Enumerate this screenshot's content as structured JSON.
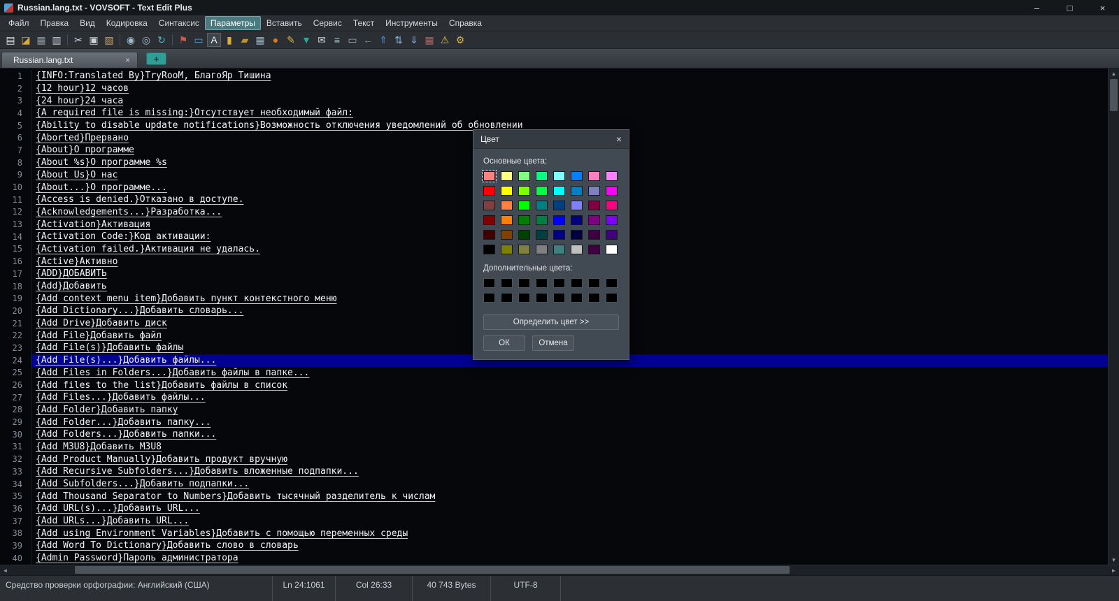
{
  "window": {
    "title": "Russian.lang.txt - VOVSOFT - Text Edit Plus",
    "minimize_glyph": "–",
    "maximize_glyph": "□",
    "close_glyph": "×"
  },
  "menu": {
    "items": [
      "Файл",
      "Правка",
      "Вид",
      "Кодировка",
      "Синтаксис",
      "Параметры",
      "Вставить",
      "Сервис",
      "Текст",
      "Инструменты",
      "Справка"
    ],
    "active_index": 5
  },
  "toolbar": {
    "icons": [
      {
        "name": "new-file-icon",
        "glyph": "▤",
        "color": "#dde1e5"
      },
      {
        "name": "open-folder-icon",
        "glyph": "◪",
        "color": "#dfa92f"
      },
      {
        "name": "save-icon",
        "glyph": "▦",
        "color": "#8d979e"
      },
      {
        "name": "print-icon",
        "glyph": "▥",
        "color": "#c6cbd0"
      },
      {
        "separator": true
      },
      {
        "name": "cut-icon",
        "glyph": "✂",
        "color": "#d5d9dd"
      },
      {
        "name": "copy-icon",
        "glyph": "▣",
        "color": "#cdd2d6"
      },
      {
        "name": "paste-icon",
        "glyph": "▧",
        "color": "#c9a05b"
      },
      {
        "separator": true
      },
      {
        "name": "zoom-in-icon",
        "glyph": "◉",
        "color": "#9fb9cb"
      },
      {
        "name": "zoom-out-icon",
        "glyph": "◎",
        "color": "#9fb9cb"
      },
      {
        "name": "refresh-icon",
        "glyph": "↻",
        "color": "#52b7c4"
      },
      {
        "separator": true
      },
      {
        "name": "flag-icon",
        "glyph": "⚑",
        "color": "#d9534f"
      },
      {
        "name": "monitor-icon",
        "glyph": "▭",
        "color": "#5a9fd4"
      },
      {
        "name": "font-icon",
        "glyph": "A",
        "color": "#f2f4f6",
        "pressed": true
      },
      {
        "name": "lock-icon",
        "glyph": "▮",
        "color": "#dcae31"
      },
      {
        "name": "archive-icon",
        "glyph": "▰",
        "color": "#b9933c"
      },
      {
        "name": "table-icon",
        "glyph": "▦",
        "color": "#8fb3c9"
      },
      {
        "name": "globe-icon",
        "glyph": "●",
        "color": "#e2761b"
      },
      {
        "name": "pen-icon",
        "glyph": "✎",
        "color": "#d8b34d"
      },
      {
        "name": "filter-icon",
        "glyph": "▼",
        "color": "#30a59b"
      },
      {
        "name": "mail-icon",
        "glyph": "✉",
        "color": "#d5d9dd"
      },
      {
        "name": "list-icon",
        "glyph": "≡",
        "color": "#9fd2e8"
      },
      {
        "name": "drive-icon",
        "glyph": "▭",
        "color": "#98a3ab"
      },
      {
        "name": "back-icon",
        "glyph": "←",
        "color": "#37b3a4"
      },
      {
        "name": "up-icon",
        "glyph": "⇑",
        "color": "#4a90d9"
      },
      {
        "name": "sort-asc-icon",
        "glyph": "⇅",
        "color": "#7fb2dd"
      },
      {
        "name": "sort-desc-icon",
        "glyph": "⇓",
        "color": "#7fb2dd"
      },
      {
        "name": "calendar-icon",
        "glyph": "▦",
        "color": "#c25b5b"
      },
      {
        "name": "warning-icon",
        "glyph": "⚠",
        "color": "#e0c23a"
      },
      {
        "name": "settings-icon",
        "glyph": "⚙",
        "color": "#d9b64a"
      }
    ]
  },
  "tabs": {
    "active_label": "Russian.lang.txt",
    "close_glyph": "×",
    "add_glyph": "+"
  },
  "editor": {
    "highlighted_line": 24,
    "lines": [
      {
        "n": 1,
        "t": "{INFO:Translated By}TryRooM, БлагоЯр Тишина"
      },
      {
        "n": 2,
        "t": "{12 hour}12 часов"
      },
      {
        "n": 3,
        "t": "{24 hour}24 часа"
      },
      {
        "n": 4,
        "t": "{A required file is missing:}Отсутствует необходимый файл:"
      },
      {
        "n": 5,
        "t": "{Ability to disable update notifications}Возможность отключения уведомлений об обновлении"
      },
      {
        "n": 6,
        "t": "{Aborted}Прервано"
      },
      {
        "n": 7,
        "t": "{About}О программе"
      },
      {
        "n": 8,
        "t": "{About %s}О программе %s"
      },
      {
        "n": 9,
        "t": "{About Us}О нас"
      },
      {
        "n": 10,
        "t": "{About...}О программе..."
      },
      {
        "n": 11,
        "t": "{Access is denied.}Отказано в доступе."
      },
      {
        "n": 12,
        "t": "{Acknowledgements...}Разработка..."
      },
      {
        "n": 13,
        "t": "{Activation}Активация"
      },
      {
        "n": 14,
        "t": "{Activation Code:}Код активации:"
      },
      {
        "n": 15,
        "t": "{Activation failed.}Активация не удалась."
      },
      {
        "n": 16,
        "t": "{Active}Активно"
      },
      {
        "n": 17,
        "t": "{ADD}ДОБАВИТЬ"
      },
      {
        "n": 18,
        "t": "{Add}Добавить"
      },
      {
        "n": 19,
        "t": "{Add context menu item}Добавить пункт контекстного меню"
      },
      {
        "n": 20,
        "t": "{Add Dictionary...}Добавить словарь..."
      },
      {
        "n": 21,
        "t": "{Add Drive}Добавить диск"
      },
      {
        "n": 22,
        "t": "{Add File}Добавить файл"
      },
      {
        "n": 23,
        "t": "{Add File(s)}Добавить файлы"
      },
      {
        "n": 24,
        "t": "{Add File(s)...}Добавить файлы..."
      },
      {
        "n": 25,
        "t": "{Add Files in Folders...}Добавить файлы в папке..."
      },
      {
        "n": 26,
        "t": "{Add files to the list}Добавить файлы в список"
      },
      {
        "n": 27,
        "t": "{Add Files...}Добавить файлы..."
      },
      {
        "n": 28,
        "t": "{Add Folder}Добавить папку"
      },
      {
        "n": 29,
        "t": "{Add Folder...}Добавить папку..."
      },
      {
        "n": 30,
        "t": "{Add Folders...}Добавить папки..."
      },
      {
        "n": 31,
        "t": "{Add M3U8}Добавить M3U8"
      },
      {
        "n": 32,
        "t": "{Add Product Manually}Добавить продукт вручную"
      },
      {
        "n": 33,
        "t": "{Add Recursive Subfolders...}Добавить вложенные подпапки..."
      },
      {
        "n": 34,
        "t": "{Add Subfolders...}Добавить подпапки..."
      },
      {
        "n": 35,
        "t": "{Add Thousand Separator to Numbers}Добавить тысячный разделитель к числам"
      },
      {
        "n": 36,
        "t": "{Add URL(s)...}Добавить URL..."
      },
      {
        "n": 37,
        "t": "{Add URLs...}Добавить URL..."
      },
      {
        "n": 38,
        "t": "{Add using Environment Variables}Добавить с помощью переменных среды"
      },
      {
        "n": 39,
        "t": "{Add Word To Dictionary}Добавить слово в словарь"
      },
      {
        "n": 40,
        "t": "{Admin Password}Пароль администратора"
      }
    ]
  },
  "dialog": {
    "title": "Цвет",
    "close_glyph": "×",
    "basic_label": "Основные цвета:",
    "custom_label": "Дополнительные цвета:",
    "define_button": "Определить цвет >>",
    "ok_button": "ОК",
    "cancel_button": "Отмена",
    "selected_index": 0,
    "basic_colors": [
      "#FF8080",
      "#FFFF80",
      "#80FF80",
      "#00FF80",
      "#80FFFF",
      "#0080FF",
      "#FF80C0",
      "#FF80FF",
      "#FF0000",
      "#FFFF00",
      "#80FF00",
      "#00FF40",
      "#00FFFF",
      "#0080C0",
      "#8080C0",
      "#FF00FF",
      "#804040",
      "#FF8040",
      "#00FF00",
      "#008080",
      "#004080",
      "#8080FF",
      "#800040",
      "#FF0080",
      "#800000",
      "#FF8000",
      "#008000",
      "#008040",
      "#0000FF",
      "#000080",
      "#800080",
      "#8000FF",
      "#400000",
      "#804000",
      "#004000",
      "#004040",
      "#000080",
      "#000040",
      "#400040",
      "#400080",
      "#000000",
      "#808000",
      "#808040",
      "#808080",
      "#408080",
      "#C0C0C0",
      "#400040",
      "#FFFFFF"
    ],
    "custom_colors": [
      "#000000",
      "#000000",
      "#000000",
      "#000000",
      "#000000",
      "#000000",
      "#000000",
      "#000000",
      "#000000",
      "#000000",
      "#000000",
      "#000000",
      "#000000",
      "#000000",
      "#000000",
      "#000000"
    ]
  },
  "status_bar": {
    "spell": "Средство проверки орфографии: Английский (США)",
    "line": "Ln 24:1061",
    "column": "Col 26:33",
    "bytes": "40 743 Bytes",
    "encoding": "UTF-8"
  },
  "scrollbar": {
    "left_glyph": "◄",
    "right_glyph": "►",
    "up_glyph": "▲",
    "down_glyph": "▼"
  }
}
